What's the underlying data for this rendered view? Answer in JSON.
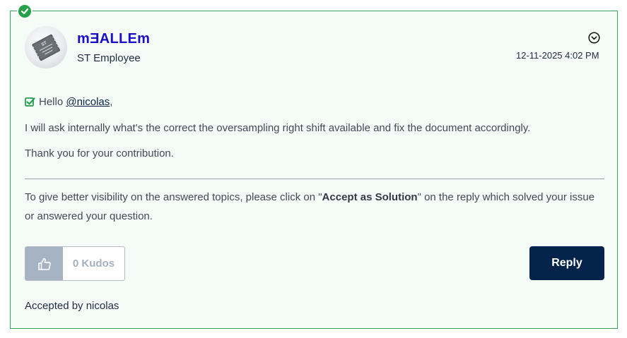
{
  "author": {
    "name": "mƎALLEm",
    "rank": "ST Employee",
    "avatar_icon": "chip-avatar-icon"
  },
  "post": {
    "date": "12-11-2025 4:02 PM",
    "greeting_prefix": "Hello",
    "mention": "@nicolas",
    "greeting_suffix": ",",
    "line1": "I will ask internally what's the correct the oversampling right shift available and fix the document accordingly.",
    "line2": "Thank you for your contribution."
  },
  "signature": {
    "before": "To give better visibility on the answered topics, please click on \"",
    "bold": "Accept as Solution",
    "after": "\" on the reply which solved your issue or answered your question."
  },
  "kudos": {
    "icon": "thumbs-up-icon",
    "label": "0 Kudos"
  },
  "reply_label": "Reply",
  "accepted_by": "Accepted by nicolas",
  "colors": {
    "accent_green": "#25a04b",
    "author_link": "#1a0fc7",
    "reply_bg": "#03234b",
    "kudos_btn_bg": "#a6b3c3"
  }
}
